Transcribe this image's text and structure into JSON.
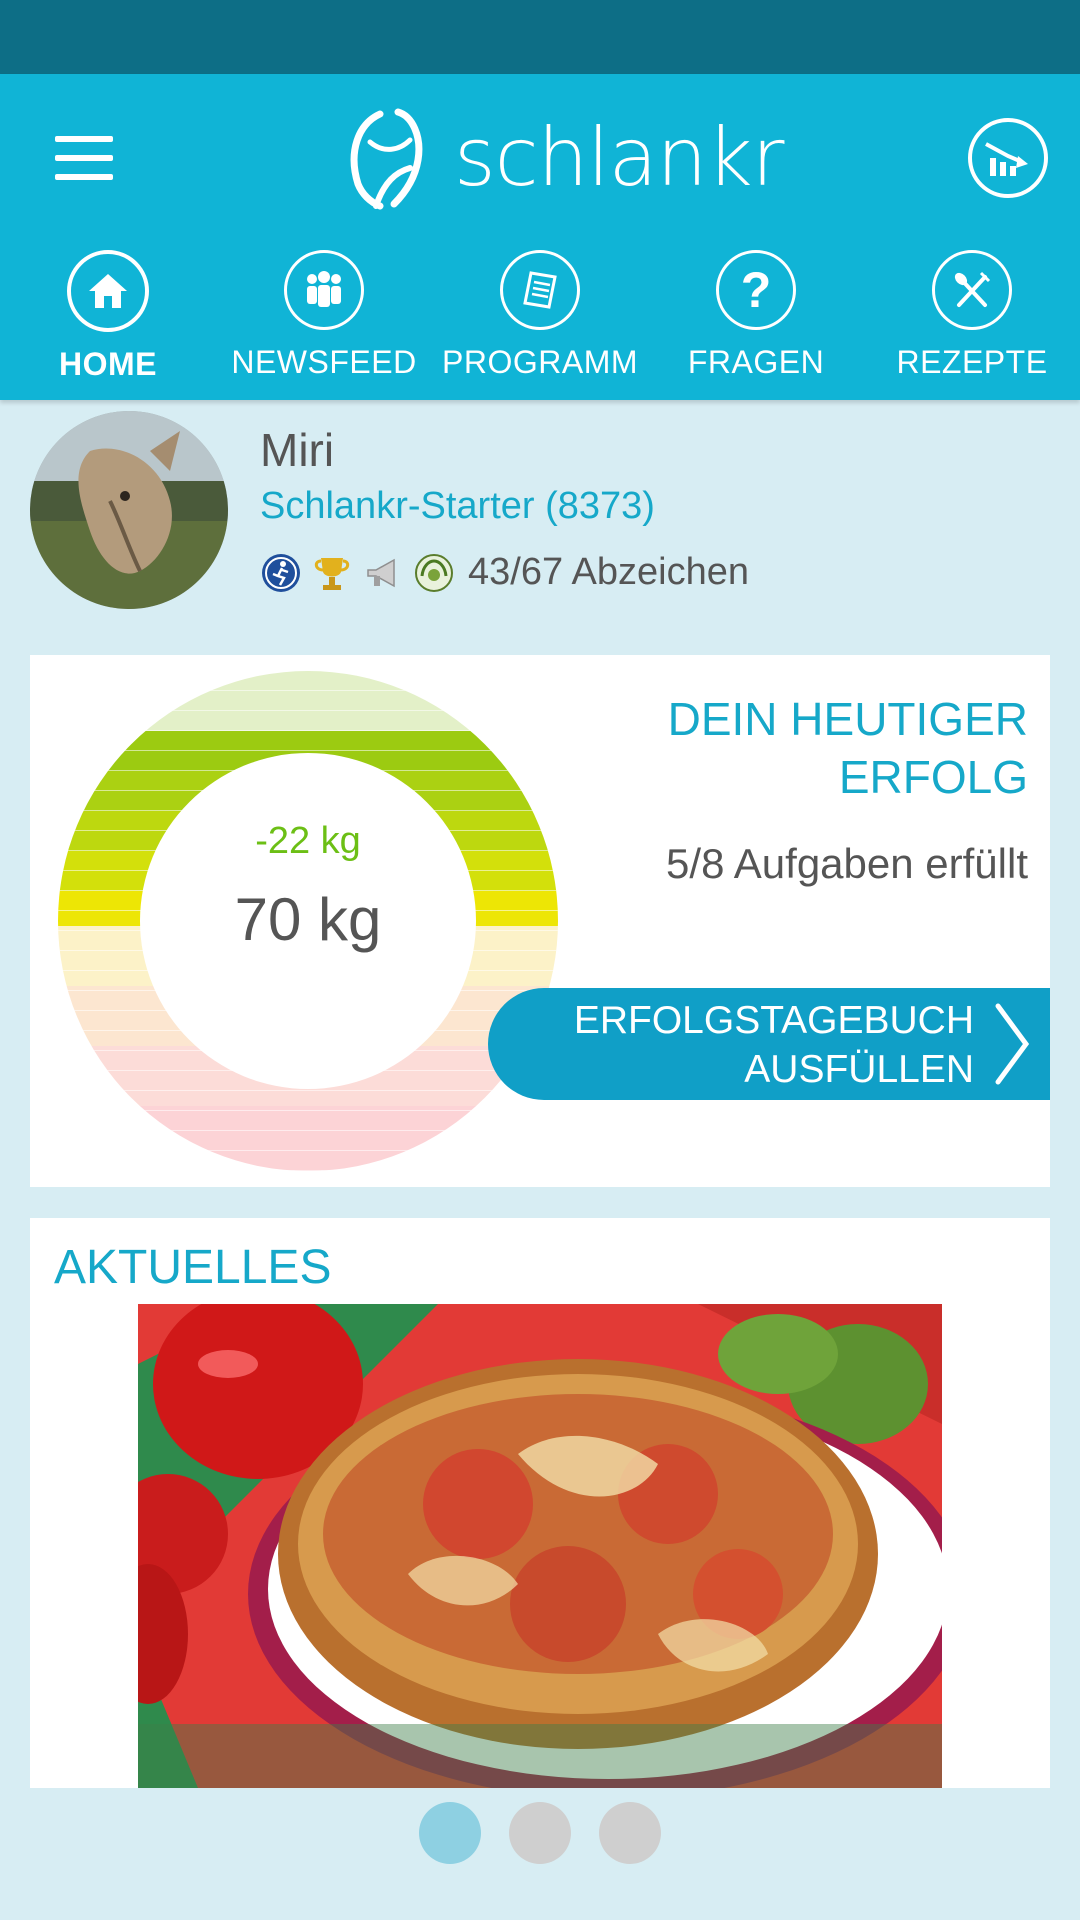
{
  "app": {
    "brand": "schlankr",
    "colors": {
      "primary": "#10b4d6",
      "status_bar": "#0d6e86",
      "accent_text": "#16a8c9",
      "positive": "#6cbf15",
      "background": "#d7edf3"
    }
  },
  "header": {
    "menu_icon": "hamburger-icon",
    "stats_icon": "weight-chart-icon"
  },
  "nav": {
    "items": [
      {
        "label": "HOME",
        "icon": "home-icon",
        "active": true
      },
      {
        "label": "NEWSFEED",
        "icon": "people-icon",
        "active": false
      },
      {
        "label": "PROGRAMM",
        "icon": "document-icon",
        "active": false
      },
      {
        "label": "FRAGEN",
        "icon": "question-icon",
        "active": false
      },
      {
        "label": "REZEPTE",
        "icon": "fork-knife-icon",
        "active": false
      }
    ]
  },
  "profile": {
    "name": "Miri",
    "level": "Schlankr-Starter (8373)",
    "badges": [
      "runner-badge-icon",
      "trophy-badge-icon",
      "megaphone-badge-icon",
      "wreath-badge-icon"
    ],
    "badge_count": "43/67 Abzeichen"
  },
  "success": {
    "title_line1": "DEIN HEUTIGER",
    "title_line2": "ERFOLG",
    "delta": "-22 kg",
    "weight": "70 kg",
    "tasks": "5/8 Aufgaben erfüllt",
    "button_line1": "ERFOLGSTAGEBUCH",
    "button_line2": "AUSFÜLLEN"
  },
  "news": {
    "title": "AKTUELLES",
    "image": "pizza-photo",
    "page_count": 3,
    "active_page": 1
  }
}
